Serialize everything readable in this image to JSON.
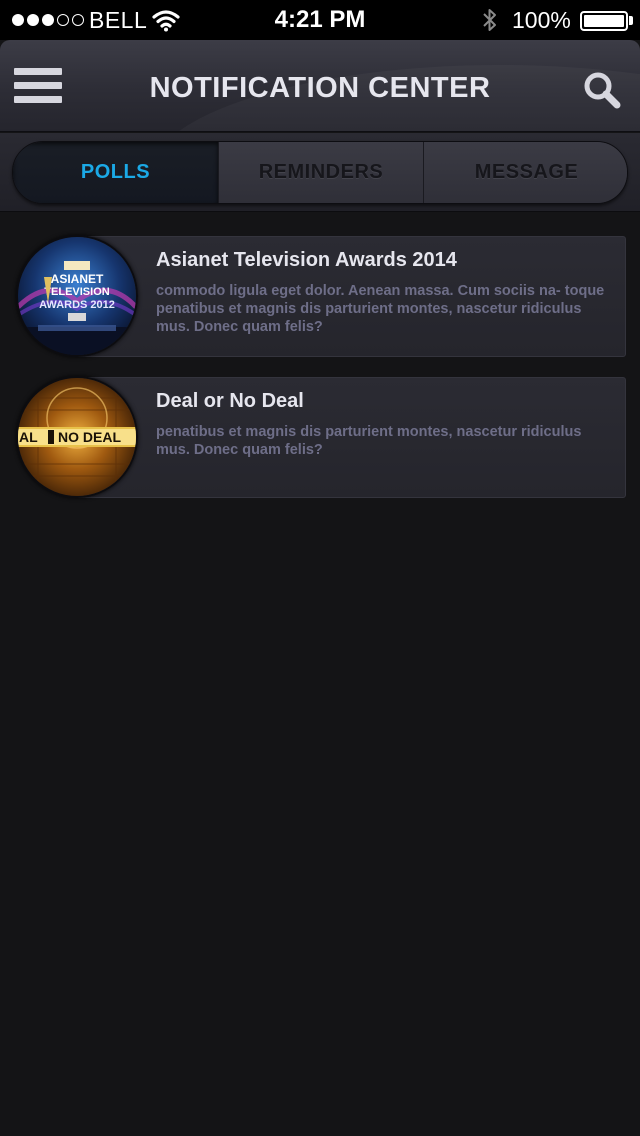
{
  "status_bar": {
    "carrier": "BELL",
    "time": "4:21 PM",
    "battery": "100%",
    "signal_bars_filled": 3,
    "signal_bars_total": 5
  },
  "header": {
    "title": "NOTIFICATION CENTER",
    "menu_icon": "hamburger-menu-icon",
    "search_icon": "search-icon"
  },
  "tabs": [
    {
      "label": "POLLS",
      "active": true
    },
    {
      "label": "REMINDERS",
      "active": false
    },
    {
      "label": "MESSAGE",
      "active": false
    }
  ],
  "notifications": [
    {
      "title": "Asianet Television Awards 2014",
      "body": "commodo ligula eget dolor. Aenean massa. Cum sociis na- toque penatibus et magnis dis parturient montes, nascetur ridiculus mus. Donec quam felis?",
      "thumbnail_text": [
        "ASIANET",
        "TELEVISION",
        "AWARDS 2012"
      ]
    },
    {
      "title": "Deal or No Deal",
      "body": "penatibus et magnis dis parturient montes, nascetur ridiculus mus. Donec quam felis?",
      "thumbnail_text": [
        "AL",
        "NO DEAL"
      ]
    }
  ],
  "colors": {
    "accent": "#1ba9e6",
    "background": "#141416",
    "card": "#28282f",
    "body_text": "#6e6e88"
  }
}
